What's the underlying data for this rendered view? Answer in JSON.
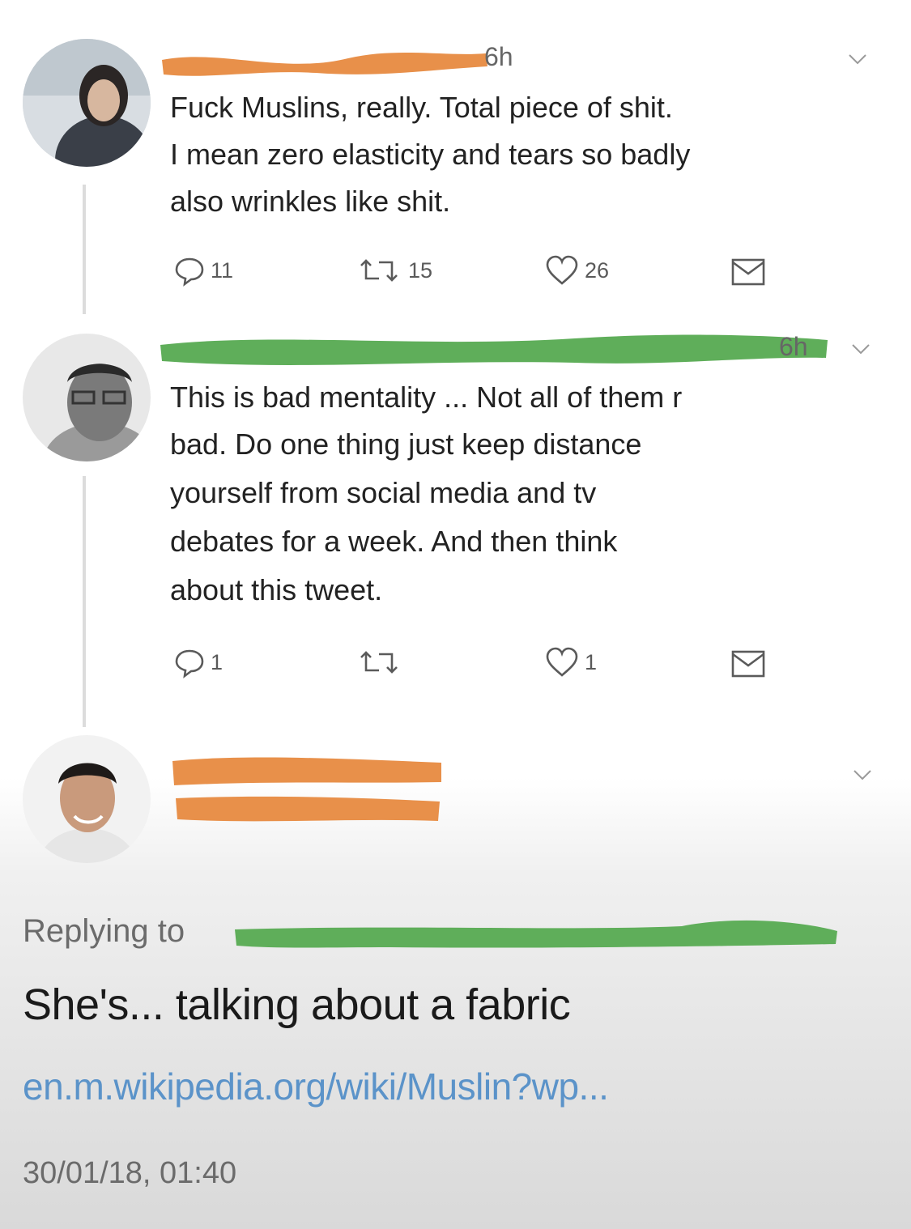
{
  "tweet1": {
    "time": "6h",
    "lines": [
      "Fuck Muslins, really. Total piece of shit.",
      "I mean zero elasticity and tears so badly",
      "also wrinkles like shit."
    ],
    "replies": "11",
    "retweets": "15",
    "likes": "26"
  },
  "tweet2": {
    "time": "6h",
    "lines": [
      "This is bad mentality ... Not all of them r",
      "bad. Do one thing just keep distance",
      "yourself from social media and tv",
      "debates for a week. And then think",
      "about this tweet."
    ],
    "replies": "1",
    "retweets": "",
    "likes": "1"
  },
  "reply": {
    "replying_to_label": "Replying to",
    "text": "She's... talking about a fabric",
    "link": "en.m.wikipedia.org/wiki/Muslin?wp...",
    "datetime": "30/01/18, 01:40"
  },
  "colors": {
    "redact_orange": "#e8904a",
    "redact_green": "#5fae5a",
    "link_blue": "#5b93c9"
  },
  "icons": [
    "reply-icon",
    "retweet-icon",
    "like-icon",
    "dm-icon",
    "chevron-down-icon"
  ]
}
